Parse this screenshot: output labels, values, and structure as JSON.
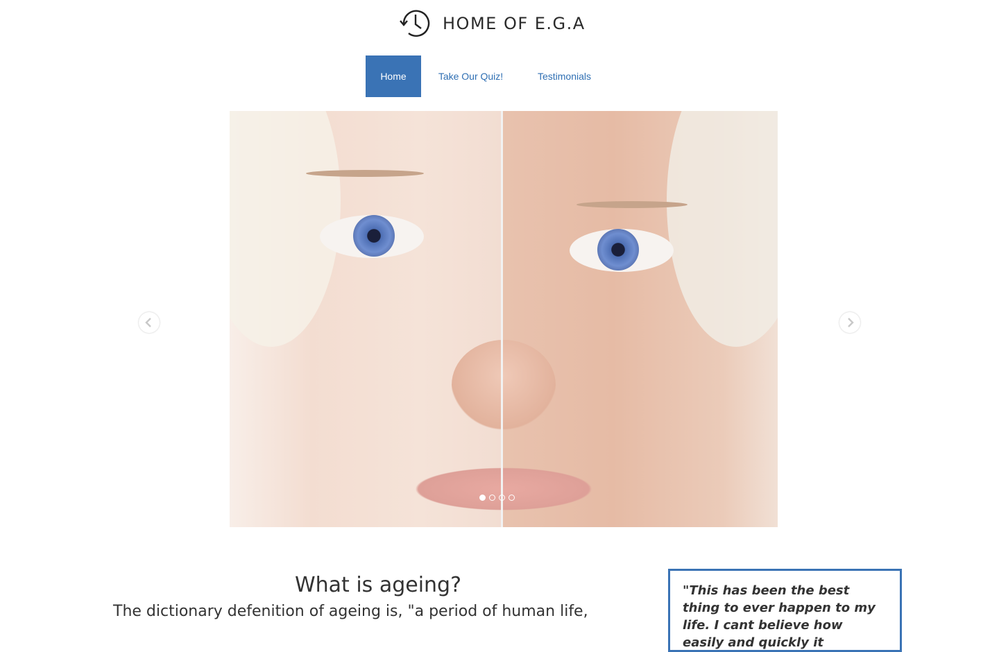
{
  "header": {
    "logo_icon": "history-clock-icon",
    "title": "HOME OF E.G.A"
  },
  "nav": {
    "items": [
      {
        "label": "Home",
        "active": true
      },
      {
        "label": "Take Our Quiz!",
        "active": false
      },
      {
        "label": "Testimonials",
        "active": false
      }
    ]
  },
  "carousel": {
    "slide_image": "young-vs-old-face-split",
    "prev_icon": "chevron-left-icon",
    "next_icon": "chevron-right-icon",
    "active_slide": 1,
    "total_slides": 4
  },
  "main": {
    "heading": "What is ageing?",
    "text": "The dictionary defenition of ageing is, \"a period of human life,"
  },
  "testimonial": {
    "quote": "\"This has been the best thing to ever happen to my life. I cant believe how easily and quickly it"
  },
  "colors": {
    "accent": "#3a73b5",
    "link": "#2f6fb3"
  }
}
